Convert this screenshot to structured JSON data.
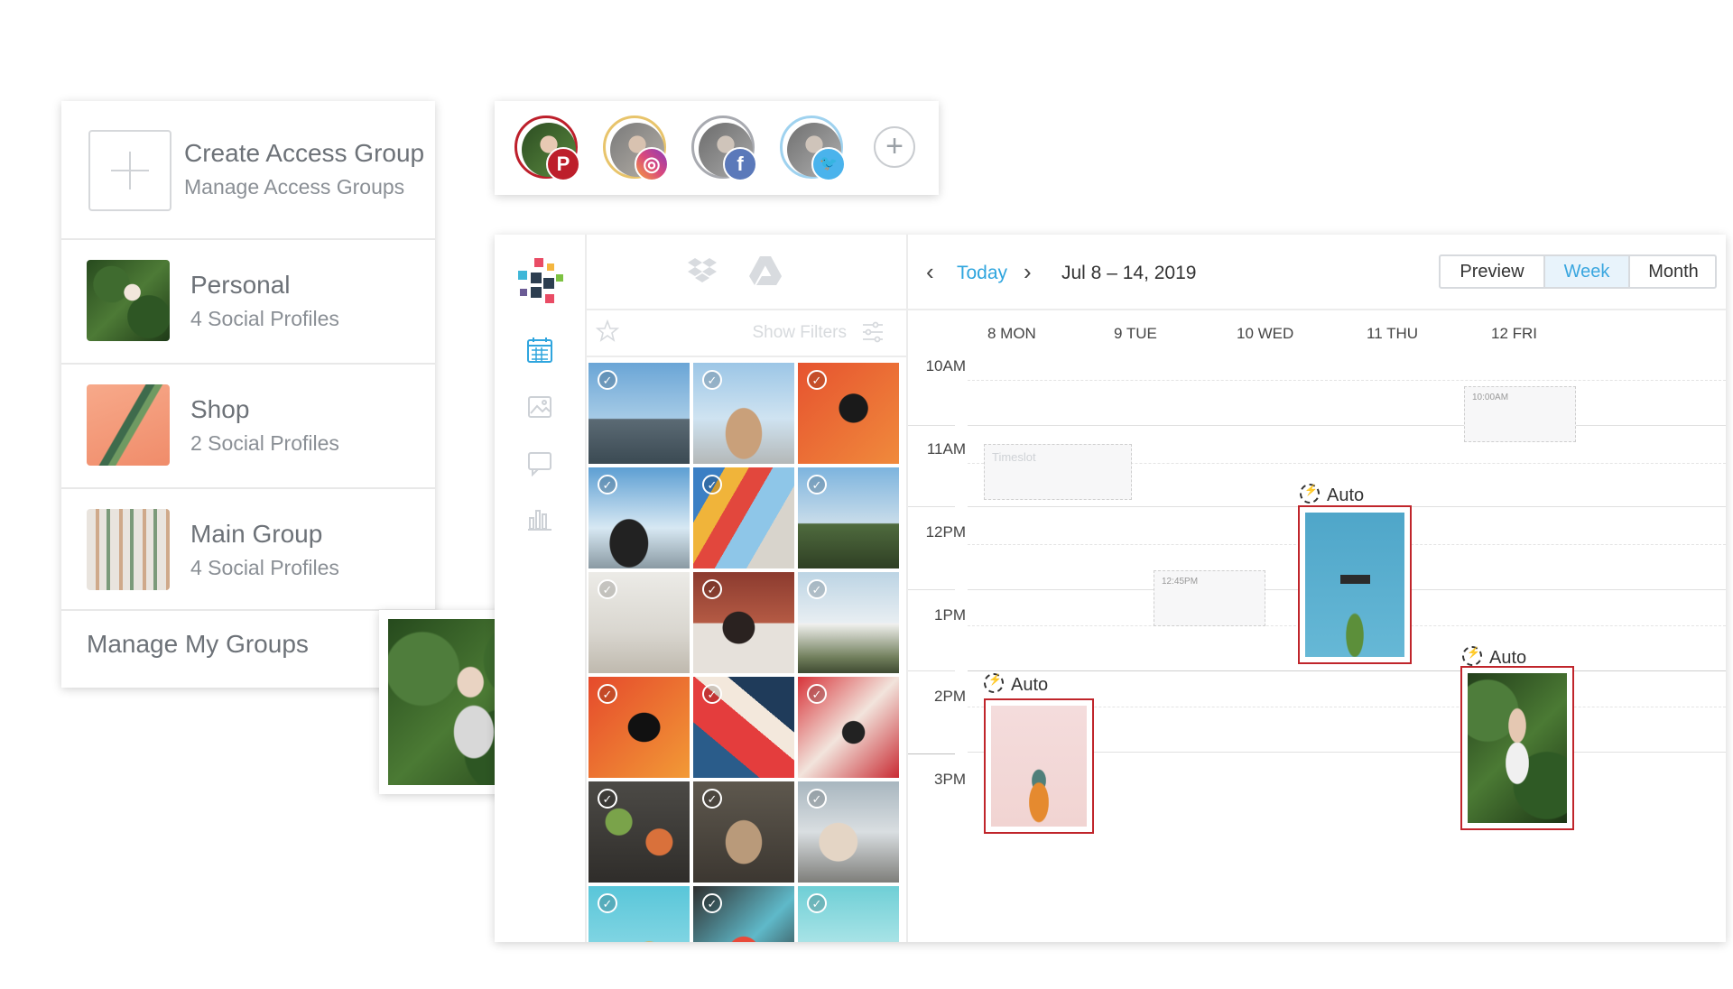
{
  "groups": {
    "create_title": "Create Access Group",
    "create_sub": "Manage Access Groups",
    "items": [
      {
        "title": "Personal",
        "sub": "4 Social Profiles"
      },
      {
        "title": "Shop",
        "sub": "2 Social Profiles"
      },
      {
        "title": "Main Group",
        "sub": "4 Social Profiles"
      }
    ],
    "manage": "Manage My Groups"
  },
  "profiles": [
    {
      "network": "pinterest-icon",
      "color": "#bd1f2b",
      "glyph": "P"
    },
    {
      "network": "instagram-icon",
      "color": "#d9487d",
      "glyph": "◎"
    },
    {
      "network": "facebook-icon",
      "color": "#5b79ba",
      "glyph": "f"
    },
    {
      "network": "twitter-icon",
      "color": "#4ab3ec",
      "glyph": "🐦"
    }
  ],
  "add_profile": "+",
  "media": {
    "filter_label": "Show Filters"
  },
  "calendar": {
    "today": "Today",
    "range": "Jul 8 – 14, 2019",
    "views": {
      "preview": "Preview",
      "week": "Week",
      "month": "Month"
    },
    "active_view": "Week",
    "days": [
      "8 MON",
      "9 TUE",
      "10 WED",
      "11 THU",
      "12 FRI"
    ],
    "hours": [
      "10AM",
      "11AM",
      "12PM",
      "1PM",
      "2PM",
      "3PM"
    ],
    "slots": [
      {
        "label": "10:00AM"
      },
      {
        "label": "Timeslot"
      },
      {
        "label": "12:45PM"
      }
    ],
    "auto_label": "Auto"
  },
  "colors": {
    "accent": "#2fa5de",
    "post_border": "#c0252b"
  }
}
